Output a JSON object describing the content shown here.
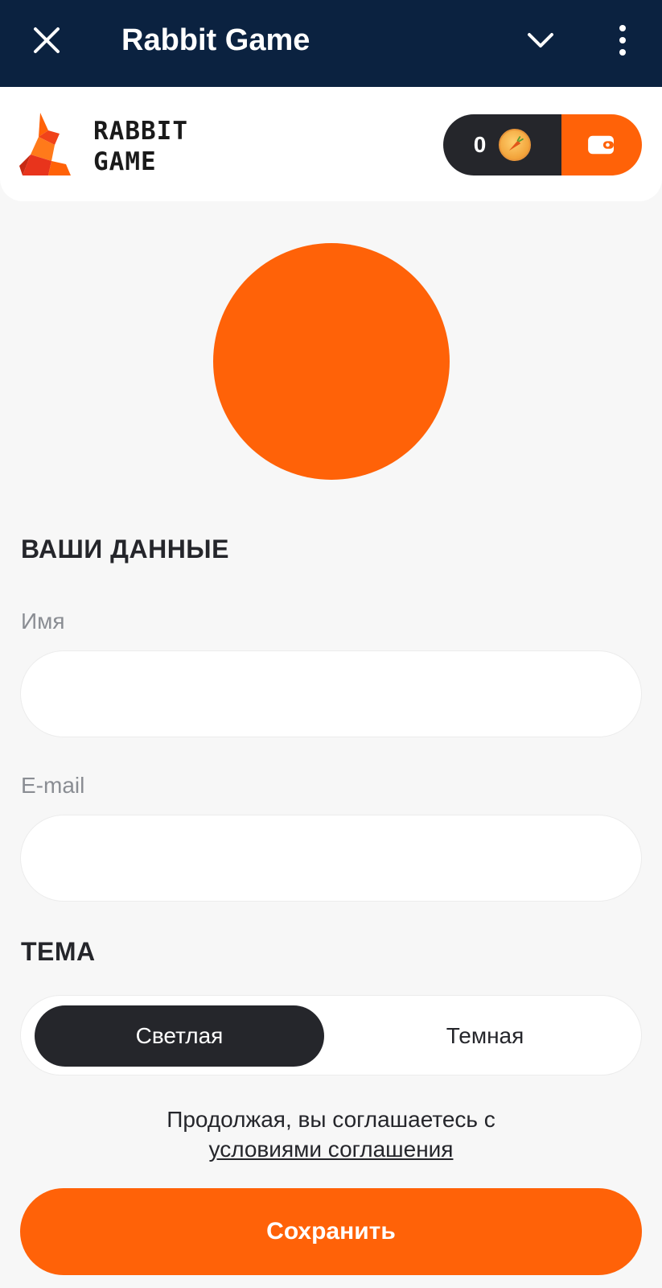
{
  "app_bar": {
    "title": "Rabbit Game",
    "close_icon": "close-icon",
    "expand_icon": "chevron-down-icon",
    "menu_icon": "more-vertical-icon"
  },
  "header": {
    "logo_line1": "RABBIT",
    "logo_line2": "GAME",
    "balance": "0",
    "coin_icon": "carrot-coin-icon",
    "wallet_icon": "wallet-icon"
  },
  "profile": {
    "section_title": "ВАШИ ДАННЫЕ",
    "name_label": "Имя",
    "name_value": "",
    "email_label": "E-mail",
    "email_value": ""
  },
  "theme": {
    "section_title": "ТЕМА",
    "options": [
      "Светлая",
      "Темная"
    ],
    "selected": "Светлая"
  },
  "terms": {
    "text": "Продолжая, вы соглашаетесь с",
    "link": "условиями соглашения"
  },
  "save_label": "Сохранить",
  "colors": {
    "accent": "#ff6208",
    "app_bar": "#0b2240",
    "dark": "#25262b",
    "background": "#f7f7f7"
  }
}
